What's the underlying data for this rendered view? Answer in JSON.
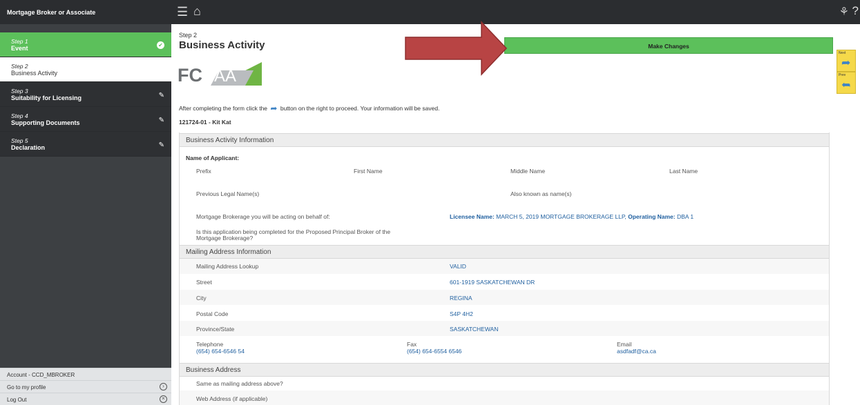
{
  "sidebar": {
    "title": "Mortgage Broker or Associate",
    "steps": [
      {
        "num": "Step 1",
        "label": "Event",
        "state": "done",
        "icon": "check-circle-icon"
      },
      {
        "num": "Step 2",
        "label": "Business Activity",
        "state": "current",
        "icon": ""
      },
      {
        "num": "Step 3",
        "label": "Suitability for Licensing",
        "state": "todo",
        "icon": "pencil-icon"
      },
      {
        "num": "Step 4",
        "label": "Supporting Documents",
        "state": "todo",
        "icon": "pencil-icon"
      },
      {
        "num": "Step 5",
        "label": "Declaration",
        "state": "todo",
        "icon": "pencil-icon"
      }
    ],
    "account": "Account - CCD_MBROKER",
    "profile_link": "Go to my profile",
    "logout_link": "Log Out"
  },
  "header": {
    "step_small": "Step 2",
    "title": "Business Activity",
    "make_changes": "Make Changes",
    "logo_text": "FCAA",
    "intro_before": "After completing the form click the",
    "intro_after": "button on the right to proceed. Your information will be saved.",
    "app_id": "121724-01 - Kit Kat"
  },
  "nav_buttons": {
    "next": "Next",
    "prev": "Prev"
  },
  "business_activity": {
    "section_title": "Business Activity Information",
    "name_heading": "Name of Applicant:",
    "prefix": "Prefix",
    "first_name": "First Name",
    "middle_name": "Middle Name",
    "last_name": "Last Name",
    "previous_names": "Previous Legal Name(s)",
    "aka": "Also known as name(s)",
    "brokerage_label": "Mortgage Brokerage you will be acting on behalf of:",
    "licensee_label": "Licensee Name:",
    "licensee_value": "MARCH 5, 2019 MORTGAGE BROKERAGE LLP,",
    "operating_label": "Operating Name:",
    "operating_value": "DBA 1",
    "principal_q1": "Is this application being completed for the Proposed Principal Broker of the",
    "principal_q2": "Mortgage Brokerage?"
  },
  "mailing": {
    "section_title": "Mailing Address Information",
    "lookup_label": "Mailing Address Lookup",
    "lookup_value": "VALID",
    "street_label": "Street",
    "street_value": "601-1919 SASKATCHEWAN DR",
    "city_label": "City",
    "city_value": "REGINA",
    "postal_label": "Postal Code",
    "postal_value": "S4P 4H2",
    "province_label": "Province/State",
    "province_value": "SASKATCHEWAN",
    "telephone_label": "Telephone",
    "telephone_value": "(654) 654-6546 54",
    "fax_label": "Fax",
    "fax_value": "(654) 654-6554 6546",
    "email_label": "Email",
    "email_value": "asdfadf@ca.ca"
  },
  "business_address": {
    "section_title": "Business Address",
    "same_as": "Same as mailing address above?",
    "web": "Web Address (if applicable)"
  },
  "colors": {
    "accent_green": "#5cc05b",
    "dark_bar": "#2b2d30",
    "arrow_red": "#b84444",
    "link_blue": "#1f5f9f",
    "nav_yellow": "#f5d94a"
  }
}
